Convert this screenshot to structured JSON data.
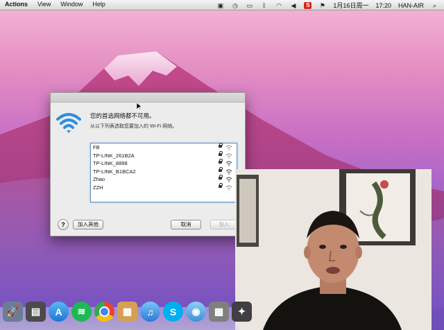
{
  "menubar": {
    "items": [
      "Actions",
      "View",
      "Window",
      "Help"
    ],
    "date": "1月16日周一",
    "time": "17:20",
    "user": "HAN-AIR",
    "tray_icons": [
      "camera-icon",
      "time-machine-icon",
      "battery-icon",
      "bluetooth-icon",
      "wifi-icon",
      "volume-icon",
      "app-s-icon",
      "flag-icon"
    ]
  },
  "dialog": {
    "title": "您的首选网络都不可用。",
    "subtitle": "从以下列表选取您要加入的 Wi-Fi 网络。",
    "networks": [
      {
        "name": "FB"
      },
      {
        "name": "TP-LINK_261B2A"
      },
      {
        "name": "TP-LINK_8898"
      },
      {
        "name": "TP-LINK_B1BCA2"
      },
      {
        "name": "Zhao"
      },
      {
        "name": "ZZH"
      }
    ],
    "help_label": "?",
    "join_other_label": "加入其他",
    "cancel_label": "取消",
    "join_label": "加入"
  },
  "dock": {
    "icons": [
      "finder-icon",
      "launchpad-icon",
      "photo-booth-icon",
      "app-store-icon",
      "spotify-icon",
      "chrome-icon",
      "package-icon",
      "itunes-icon",
      "skype-icon",
      "facetime-icon",
      "image-capture-icon",
      "imovie-icon"
    ]
  },
  "colors": {
    "accent": "#2f8de0",
    "wallpaper_top": "#f3b9d5",
    "wallpaper_bottom": "#6d4db8"
  }
}
